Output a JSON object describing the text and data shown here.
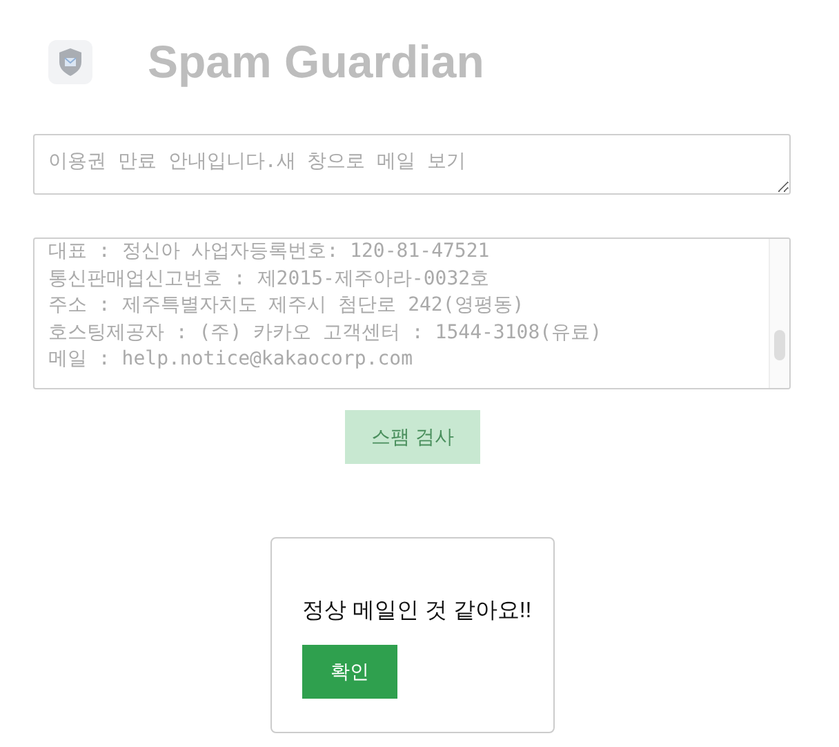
{
  "header": {
    "title": "Spam Guardian"
  },
  "subject_field": {
    "value": "이용권 만료 안내입니다.새 창으로 메일 보기",
    "disabled": true
  },
  "body_field": {
    "disabled": true,
    "lines": [
      "대표 : 정신아 사업자등록번호: 120-81-47521",
      "통신판매업신고번호 : 제2015-제주아라-0032호",
      "주소 : 제주특별자치도 제주시 첨단로 242(영평동)",
      "호스팅제공자 : (주) 카카오 고객센터 : 1544-3108(유료)",
      "메일 : help.notice@kakaocorp.com"
    ]
  },
  "scan_button": {
    "label": "스팸 검사",
    "disabled": true
  },
  "dialog": {
    "message": "정상 메일인 것 같아요!!",
    "button": "확인"
  }
}
